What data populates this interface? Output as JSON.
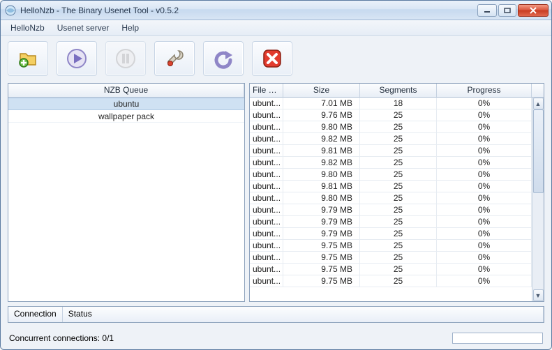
{
  "window": {
    "title": "HelloNzb - The Binary Usenet Tool - v0.5.2"
  },
  "menu": {
    "items": [
      "HelloNzb",
      "Usenet server",
      "Help"
    ]
  },
  "toolbar": {
    "buttons": [
      {
        "name": "open-nzb-button",
        "icon": "folder-plus",
        "enabled": true
      },
      {
        "name": "start-button",
        "icon": "play",
        "enabled": true
      },
      {
        "name": "pause-button",
        "icon": "pause",
        "enabled": false
      },
      {
        "name": "settings-button",
        "icon": "wrench",
        "enabled": true
      },
      {
        "name": "requeue-button",
        "icon": "undo",
        "enabled": true
      },
      {
        "name": "cancel-button",
        "icon": "stop",
        "enabled": true
      }
    ]
  },
  "queue": {
    "header": "NZB Queue",
    "items": [
      {
        "label": "ubuntu",
        "selected": true
      },
      {
        "label": "wallpaper pack",
        "selected": false
      }
    ]
  },
  "files": {
    "headers": {
      "file": "File n...",
      "size": "Size",
      "segments": "Segments",
      "progress": "Progress"
    },
    "rows": [
      {
        "file": "ubunt...",
        "size": "7.01 MB",
        "segments": "18",
        "progress": "0%"
      },
      {
        "file": "ubunt...",
        "size": "9.76 MB",
        "segments": "25",
        "progress": "0%"
      },
      {
        "file": "ubunt...",
        "size": "9.80 MB",
        "segments": "25",
        "progress": "0%"
      },
      {
        "file": "ubunt...",
        "size": "9.82 MB",
        "segments": "25",
        "progress": "0%"
      },
      {
        "file": "ubunt...",
        "size": "9.81 MB",
        "segments": "25",
        "progress": "0%"
      },
      {
        "file": "ubunt...",
        "size": "9.82 MB",
        "segments": "25",
        "progress": "0%"
      },
      {
        "file": "ubunt...",
        "size": "9.80 MB",
        "segments": "25",
        "progress": "0%"
      },
      {
        "file": "ubunt...",
        "size": "9.81 MB",
        "segments": "25",
        "progress": "0%"
      },
      {
        "file": "ubunt...",
        "size": "9.80 MB",
        "segments": "25",
        "progress": "0%"
      },
      {
        "file": "ubunt...",
        "size": "9.79 MB",
        "segments": "25",
        "progress": "0%"
      },
      {
        "file": "ubunt...",
        "size": "9.79 MB",
        "segments": "25",
        "progress": "0%"
      },
      {
        "file": "ubunt...",
        "size": "9.79 MB",
        "segments": "25",
        "progress": "0%"
      },
      {
        "file": "ubunt...",
        "size": "9.75 MB",
        "segments": "25",
        "progress": "0%"
      },
      {
        "file": "ubunt...",
        "size": "9.75 MB",
        "segments": "25",
        "progress": "0%"
      },
      {
        "file": "ubunt...",
        "size": "9.75 MB",
        "segments": "25",
        "progress": "0%"
      },
      {
        "file": "ubunt...",
        "size": "9.75 MB",
        "segments": "25",
        "progress": "0%"
      }
    ]
  },
  "status": {
    "connection_header": "Connection",
    "status_header": "Status"
  },
  "footer": {
    "connections_label": "Concurrent connections: 0/1"
  }
}
